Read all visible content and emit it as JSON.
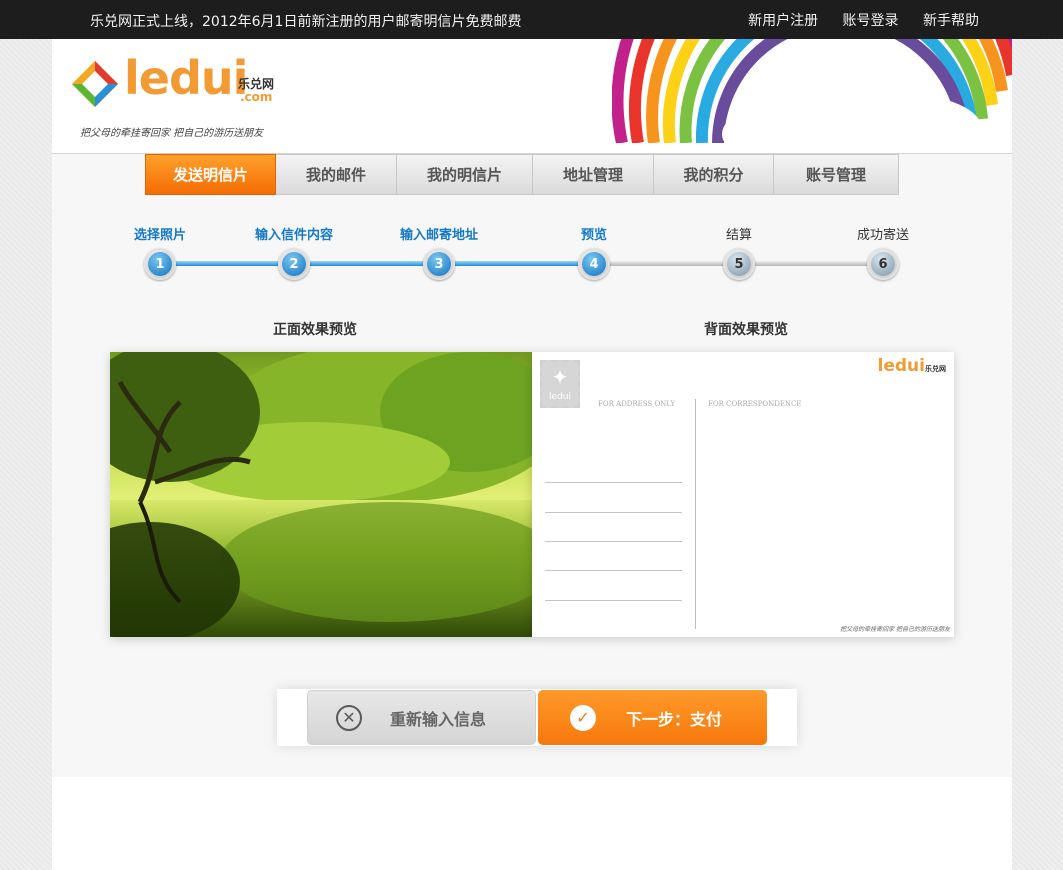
{
  "topbar": {
    "notice": "乐兑网正式上线，2012年6月1日前新注册的用户邮寄明信片免费邮费",
    "links": [
      "新用户注册",
      "账号登录",
      "新手帮助"
    ]
  },
  "logo": {
    "word": "ledui",
    "cn": "乐兑网",
    "com": ".com",
    "slogan": "把父母的牵挂寄回家  把自己的游历送朋友"
  },
  "nav": {
    "tabs": [
      "发送明信片",
      "我的邮件",
      "我的明信片",
      "地址管理",
      "我的积分",
      "账号管理"
    ]
  },
  "steps": [
    {
      "label": "选择照片",
      "num": "1",
      "done": true
    },
    {
      "label": "输入信件内容",
      "num": "2",
      "done": true
    },
    {
      "label": "输入邮寄地址",
      "num": "3",
      "done": true
    },
    {
      "label": "预览",
      "num": "4",
      "done": true
    },
    {
      "label": "结算",
      "num": "5",
      "done": false
    },
    {
      "label": "成功寄送",
      "num": "6",
      "done": false
    }
  ],
  "preview": {
    "front_label": "正面效果预览",
    "back_label": "背面效果预览",
    "stamp_text": "ledui",
    "address_header": "FOR ADDRESS ONLY",
    "correspondence_header": "FOR CORRESPONDENCE",
    "mini_logo": "ledui",
    "mini_logo_cn": "乐兑网",
    "footer": "把父母的牵挂寄回家  把自己的游历送朋友"
  },
  "buttons": {
    "reset": "重新输入信息",
    "next": "下一步：支付"
  },
  "colors": {
    "accent": "#f7780c",
    "step_done": "#1479c7",
    "topbar": "#1d1d1d"
  }
}
